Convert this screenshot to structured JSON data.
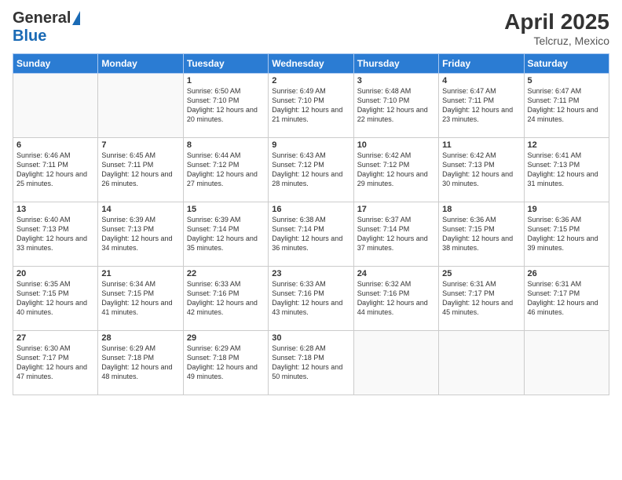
{
  "logo": {
    "general": "General",
    "blue": "Blue"
  },
  "header": {
    "month": "April 2025",
    "location": "Telcruz, Mexico"
  },
  "weekdays": [
    "Sunday",
    "Monday",
    "Tuesday",
    "Wednesday",
    "Thursday",
    "Friday",
    "Saturday"
  ],
  "weeks": [
    [
      {
        "day": "",
        "info": ""
      },
      {
        "day": "",
        "info": ""
      },
      {
        "day": "1",
        "info": "Sunrise: 6:50 AM\nSunset: 7:10 PM\nDaylight: 12 hours and 20 minutes."
      },
      {
        "day": "2",
        "info": "Sunrise: 6:49 AM\nSunset: 7:10 PM\nDaylight: 12 hours and 21 minutes."
      },
      {
        "day": "3",
        "info": "Sunrise: 6:48 AM\nSunset: 7:10 PM\nDaylight: 12 hours and 22 minutes."
      },
      {
        "day": "4",
        "info": "Sunrise: 6:47 AM\nSunset: 7:11 PM\nDaylight: 12 hours and 23 minutes."
      },
      {
        "day": "5",
        "info": "Sunrise: 6:47 AM\nSunset: 7:11 PM\nDaylight: 12 hours and 24 minutes."
      }
    ],
    [
      {
        "day": "6",
        "info": "Sunrise: 6:46 AM\nSunset: 7:11 PM\nDaylight: 12 hours and 25 minutes."
      },
      {
        "day": "7",
        "info": "Sunrise: 6:45 AM\nSunset: 7:11 PM\nDaylight: 12 hours and 26 minutes."
      },
      {
        "day": "8",
        "info": "Sunrise: 6:44 AM\nSunset: 7:12 PM\nDaylight: 12 hours and 27 minutes."
      },
      {
        "day": "9",
        "info": "Sunrise: 6:43 AM\nSunset: 7:12 PM\nDaylight: 12 hours and 28 minutes."
      },
      {
        "day": "10",
        "info": "Sunrise: 6:42 AM\nSunset: 7:12 PM\nDaylight: 12 hours and 29 minutes."
      },
      {
        "day": "11",
        "info": "Sunrise: 6:42 AM\nSunset: 7:13 PM\nDaylight: 12 hours and 30 minutes."
      },
      {
        "day": "12",
        "info": "Sunrise: 6:41 AM\nSunset: 7:13 PM\nDaylight: 12 hours and 31 minutes."
      }
    ],
    [
      {
        "day": "13",
        "info": "Sunrise: 6:40 AM\nSunset: 7:13 PM\nDaylight: 12 hours and 33 minutes."
      },
      {
        "day": "14",
        "info": "Sunrise: 6:39 AM\nSunset: 7:13 PM\nDaylight: 12 hours and 34 minutes."
      },
      {
        "day": "15",
        "info": "Sunrise: 6:39 AM\nSunset: 7:14 PM\nDaylight: 12 hours and 35 minutes."
      },
      {
        "day": "16",
        "info": "Sunrise: 6:38 AM\nSunset: 7:14 PM\nDaylight: 12 hours and 36 minutes."
      },
      {
        "day": "17",
        "info": "Sunrise: 6:37 AM\nSunset: 7:14 PM\nDaylight: 12 hours and 37 minutes."
      },
      {
        "day": "18",
        "info": "Sunrise: 6:36 AM\nSunset: 7:15 PM\nDaylight: 12 hours and 38 minutes."
      },
      {
        "day": "19",
        "info": "Sunrise: 6:36 AM\nSunset: 7:15 PM\nDaylight: 12 hours and 39 minutes."
      }
    ],
    [
      {
        "day": "20",
        "info": "Sunrise: 6:35 AM\nSunset: 7:15 PM\nDaylight: 12 hours and 40 minutes."
      },
      {
        "day": "21",
        "info": "Sunrise: 6:34 AM\nSunset: 7:15 PM\nDaylight: 12 hours and 41 minutes."
      },
      {
        "day": "22",
        "info": "Sunrise: 6:33 AM\nSunset: 7:16 PM\nDaylight: 12 hours and 42 minutes."
      },
      {
        "day": "23",
        "info": "Sunrise: 6:33 AM\nSunset: 7:16 PM\nDaylight: 12 hours and 43 minutes."
      },
      {
        "day": "24",
        "info": "Sunrise: 6:32 AM\nSunset: 7:16 PM\nDaylight: 12 hours and 44 minutes."
      },
      {
        "day": "25",
        "info": "Sunrise: 6:31 AM\nSunset: 7:17 PM\nDaylight: 12 hours and 45 minutes."
      },
      {
        "day": "26",
        "info": "Sunrise: 6:31 AM\nSunset: 7:17 PM\nDaylight: 12 hours and 46 minutes."
      }
    ],
    [
      {
        "day": "27",
        "info": "Sunrise: 6:30 AM\nSunset: 7:17 PM\nDaylight: 12 hours and 47 minutes."
      },
      {
        "day": "28",
        "info": "Sunrise: 6:29 AM\nSunset: 7:18 PM\nDaylight: 12 hours and 48 minutes."
      },
      {
        "day": "29",
        "info": "Sunrise: 6:29 AM\nSunset: 7:18 PM\nDaylight: 12 hours and 49 minutes."
      },
      {
        "day": "30",
        "info": "Sunrise: 6:28 AM\nSunset: 7:18 PM\nDaylight: 12 hours and 50 minutes."
      },
      {
        "day": "",
        "info": ""
      },
      {
        "day": "",
        "info": ""
      },
      {
        "day": "",
        "info": ""
      }
    ]
  ]
}
